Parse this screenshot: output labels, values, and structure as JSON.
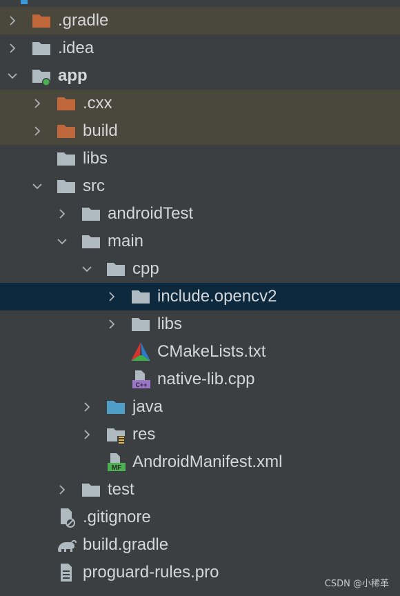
{
  "tree": {
    "items": [
      {
        "label": "gradle",
        "prefix": ".",
        "depth": 0,
        "expanded": false,
        "icon": "folder-excluded",
        "excluded": true
      },
      {
        "label": ".idea",
        "depth": 0,
        "expanded": false,
        "icon": "folder"
      },
      {
        "label": "app",
        "depth": 0,
        "expanded": true,
        "icon": "folder-module",
        "bold": true
      },
      {
        "label": ".cxx",
        "depth": 1,
        "expanded": false,
        "icon": "folder-excluded",
        "excluded": true
      },
      {
        "label": "build",
        "depth": 1,
        "expanded": false,
        "icon": "folder-excluded",
        "excluded": true
      },
      {
        "label": "libs",
        "depth": 1,
        "leaf": true,
        "icon": "folder"
      },
      {
        "label": "src",
        "depth": 1,
        "expanded": true,
        "icon": "folder"
      },
      {
        "label": "androidTest",
        "depth": 2,
        "expanded": false,
        "icon": "folder"
      },
      {
        "label": "main",
        "depth": 2,
        "expanded": true,
        "icon": "folder"
      },
      {
        "label": "cpp",
        "depth": 3,
        "expanded": true,
        "icon": "folder"
      },
      {
        "label": "include.opencv2",
        "depth": 4,
        "expanded": false,
        "icon": "folder",
        "selected": true
      },
      {
        "label": "libs",
        "depth": 4,
        "expanded": false,
        "icon": "folder"
      },
      {
        "label": "CMakeLists.txt",
        "depth": 4,
        "leaf": true,
        "icon": "cmake"
      },
      {
        "label": "native-lib.cpp",
        "depth": 4,
        "leaf": true,
        "icon": "cpp"
      },
      {
        "label": "java",
        "depth": 3,
        "expanded": false,
        "icon": "folder-source"
      },
      {
        "label": "res",
        "depth": 3,
        "expanded": false,
        "icon": "folder-resource"
      },
      {
        "label": "AndroidManifest.xml",
        "depth": 3,
        "leaf": true,
        "icon": "manifest"
      },
      {
        "label": "test",
        "depth": 2,
        "expanded": false,
        "icon": "folder"
      },
      {
        "label": ".gitignore",
        "depth": 1,
        "leaf": true,
        "icon": "gitignore"
      },
      {
        "label": "build.gradle",
        "depth": 1,
        "leaf": true,
        "icon": "gradle"
      },
      {
        "label": "proguard-rules.pro",
        "depth": 1,
        "leaf": true,
        "icon": "text-file"
      }
    ]
  },
  "watermark": "CSDN @小稀革",
  "colors": {
    "background": "#3c3f41",
    "excluded_row": "#4a473d",
    "selected_row": "#0d293e",
    "folder": "#aeb9c0",
    "folder_excluded": "#c0683b",
    "folder_source": "#4e9ec8",
    "module_dot": "#4caf50"
  }
}
